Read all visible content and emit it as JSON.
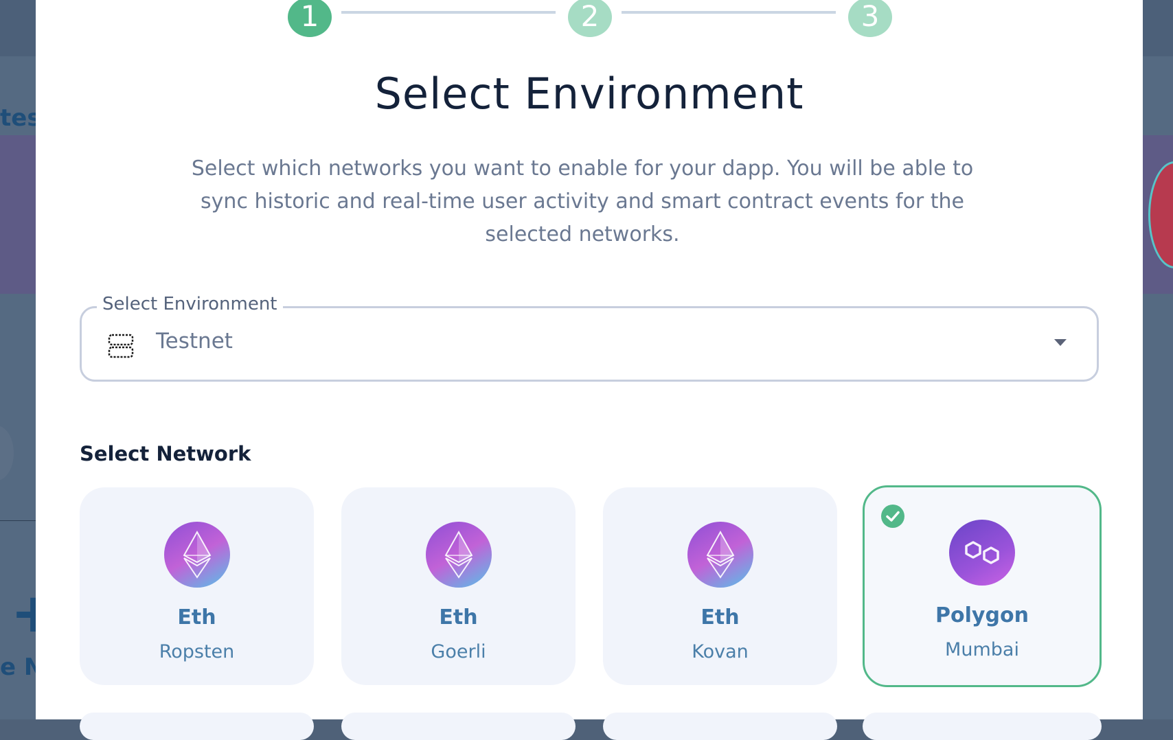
{
  "stepper": {
    "steps": [
      "1",
      "2",
      "3"
    ],
    "active_step": 1
  },
  "background": {
    "fragment_left_top": "tes",
    "fragment_left_bottom": "e Ne",
    "plus_glyph": "+"
  },
  "modal": {
    "title": "Select Environment",
    "description": "Select which networks you want to enable for your dapp. You will be able to sync historic and real-time user activity and smart contract events for the selected networks.",
    "environment_select": {
      "label": "Select Environment",
      "value": "Testnet",
      "icon": "server-icon"
    },
    "network_section_label": "Select Network",
    "networks": [
      {
        "name": "Eth",
        "subtitle": "Ropsten",
        "icon": "ethereum-icon",
        "selected": false
      },
      {
        "name": "Eth",
        "subtitle": "Goerli",
        "icon": "ethereum-icon",
        "selected": false
      },
      {
        "name": "Eth",
        "subtitle": "Kovan",
        "icon": "ethereum-icon",
        "selected": false
      },
      {
        "name": "Polygon",
        "subtitle": "Mumbai",
        "icon": "polygon-icon",
        "selected": true
      }
    ]
  },
  "colors": {
    "accent_green": "#52b889",
    "accent_green_light": "#a6dcc4",
    "title_text": "#14223a",
    "card_text": "#3e76a8",
    "card_bg": "#f1f4fb"
  }
}
